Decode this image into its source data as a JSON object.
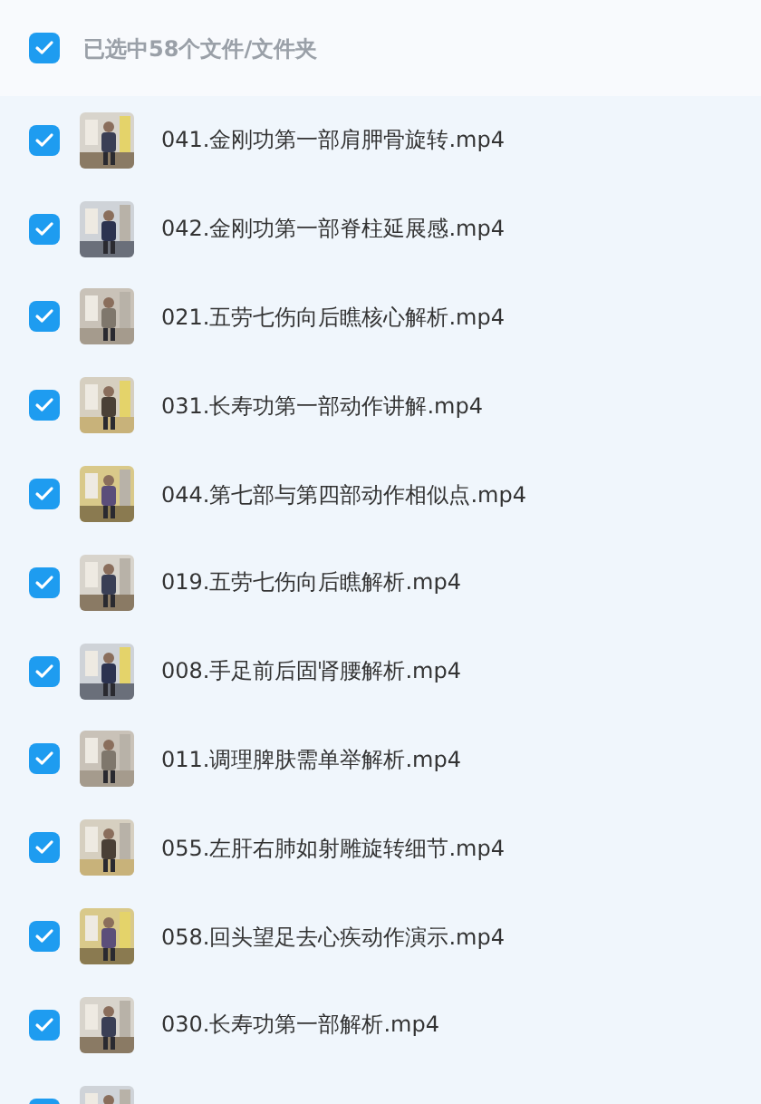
{
  "header": {
    "checked": true,
    "label": "已选中58个文件/文件夹"
  },
  "files": [
    {
      "checked": true,
      "name": "041.金刚功第一部肩胛骨旋转.mp4"
    },
    {
      "checked": true,
      "name": "042.金刚功第一部脊柱延展感.mp4"
    },
    {
      "checked": true,
      "name": "021.五劳七伤向后瞧核心解析.mp4"
    },
    {
      "checked": true,
      "name": "031.长寿功第一部动作讲解.mp4"
    },
    {
      "checked": true,
      "name": "044.第七部与第四部动作相似点.mp4"
    },
    {
      "checked": true,
      "name": "019.五劳七伤向后瞧解析.mp4"
    },
    {
      "checked": true,
      "name": "008.手足前后固肾腰解析.mp4"
    },
    {
      "checked": true,
      "name": "011.调理脾肤需单举解析.mp4"
    },
    {
      "checked": true,
      "name": "055.左肝右肺如射雕旋转细节.mp4"
    },
    {
      "checked": true,
      "name": "058.回头望足去心疾动作演示.mp4"
    },
    {
      "checked": true,
      "name": "030.长寿功第一部解析.mp4"
    },
    {
      "checked": true
    }
  ]
}
